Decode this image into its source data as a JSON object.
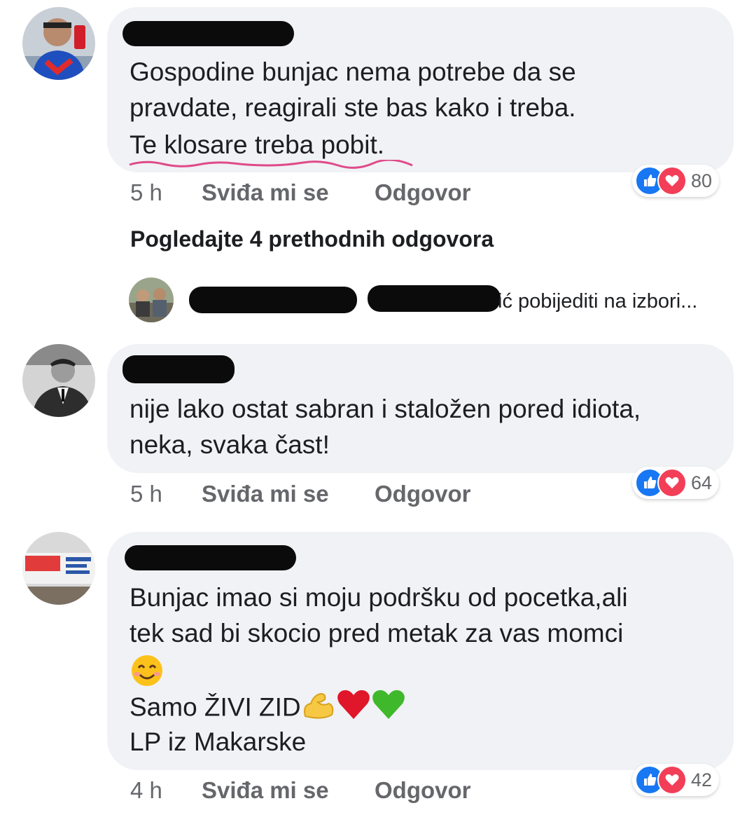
{
  "comments": [
    {
      "lines": [
        "Gospodine bunjac nema potrebe da se",
        "pravdate, reagirali ste bas kako i treba.",
        "Te klosare treba pobit."
      ],
      "time": "5 h",
      "like_label": "Sviđa mi se",
      "reply_label": "Odgovor",
      "reaction_count": "80"
    },
    {
      "lines": [
        "nije lako ostat sabran i staložen pored idiota,",
        "neka, svaka čast!"
      ],
      "time": "5 h",
      "like_label": "Sviđa mi se",
      "reply_label": "Odgovor",
      "reaction_count": "64"
    },
    {
      "lines": [
        "Bunjac imao si moju podršku od pocetka,ali",
        "tek sad bi skocio pred metak za vas momci"
      ],
      "line4": "Samo ŽIVI ZID",
      "line5": "LP iz Makarske",
      "time": "4 h",
      "like_label": "Sviđa mi se",
      "reply_label": "Odgovor",
      "reaction_count": "42"
    }
  ],
  "view_previous": "Pogledajte 4 prethodnih odgovora",
  "reply_preview": {
    "name_suffix": "ić",
    "text": "pobijediti na izbori..."
  },
  "icons": [
    "like-icon",
    "love-icon",
    "smile-emoji-icon",
    "flexed-biceps-icon",
    "red-heart-icon",
    "green-heart-icon"
  ],
  "colors": {
    "like_blue": "#1877f2",
    "love_red": "#f33e58",
    "bubble": "#f0f2f5",
    "meta_gray": "#65676b"
  }
}
